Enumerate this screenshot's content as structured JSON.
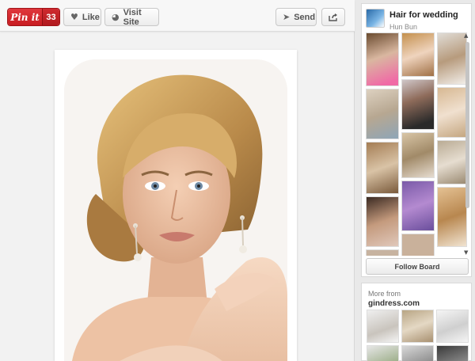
{
  "toolbar": {
    "pin_label": "Pin it",
    "pin_count": "33",
    "like_label": "Like",
    "visit_label": "Visit Site",
    "send_label": "Send"
  },
  "board": {
    "title": "Hair for wedding",
    "owner": "Hun Bun",
    "follow_label": "Follow Board"
  },
  "more": {
    "label": "More from",
    "domain": "gindress.com"
  },
  "icons": {
    "like": "heart-icon",
    "visit": "globe-icon",
    "send": "send-icon",
    "share": "share-icon"
  },
  "colors": {
    "pin_red": "#c81d22",
    "button_text": "#555555"
  }
}
